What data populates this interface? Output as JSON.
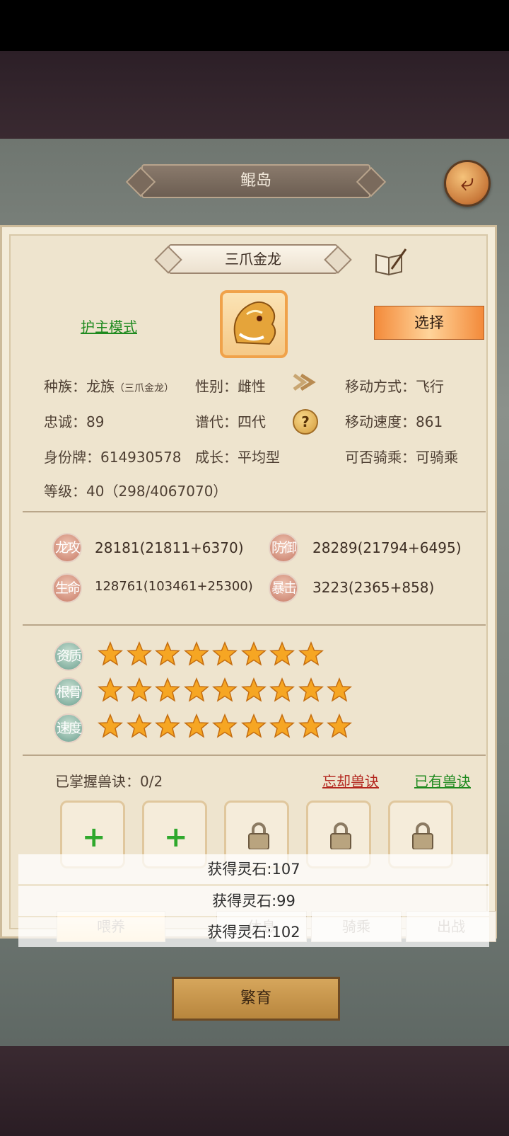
{
  "header": {
    "title": "鲲岛",
    "back_icon": "back-arrow-icon"
  },
  "pet": {
    "name": "三爪金龙",
    "guard_mode": "护主模式",
    "select_label": "选择",
    "info": {
      "race_label": "种族：",
      "race_value": "龙族",
      "race_sub": "（三爪金龙）",
      "gender_label": "性别：",
      "gender_value": "雌性",
      "move_label": "移动方式：",
      "move_value": "飞行",
      "loyalty_label": "忠诚：",
      "loyalty_value": "89",
      "generation_label": "谱代：",
      "generation_value": "四代",
      "speed_label": "移动速度：",
      "speed_value": "861",
      "id_label": "身份牌：",
      "id_value": "614930578",
      "growth_label": "成长：",
      "growth_value": "平均型",
      "ride_label": "可否骑乘：",
      "ride_value": "可骑乘",
      "level_label": "等级：",
      "level_value": "40（298/4067070）"
    },
    "stats": {
      "attack_label": "龙攻",
      "attack_value": "28181(21811+6370)",
      "defense_label": "防御",
      "defense_value": "28289(21794+6495)",
      "hp_label": "生命",
      "hp_value": "128761(103461+25300)",
      "crit_label": "暴击",
      "crit_value": "3223(2365+858)"
    },
    "ratings": [
      {
        "label": "资质",
        "stars": 8
      },
      {
        "label": "根骨",
        "stars": 9
      },
      {
        "label": "速度",
        "stars": 9
      }
    ],
    "skills": {
      "mastered": "已掌握兽诀：0/2",
      "forget": "忘却兽诀",
      "owned": "已有兽诀"
    }
  },
  "tabs": [
    "喂养",
    "休息",
    "骑乘",
    "出战"
  ],
  "toasts": [
    "获得灵石:107",
    "获得灵石:99",
    "获得灵石:102"
  ],
  "breed_label": "繁育",
  "colors": {
    "accent": "#f38a3a",
    "link_green": "#1f8a1f",
    "link_red": "#b3261e"
  }
}
